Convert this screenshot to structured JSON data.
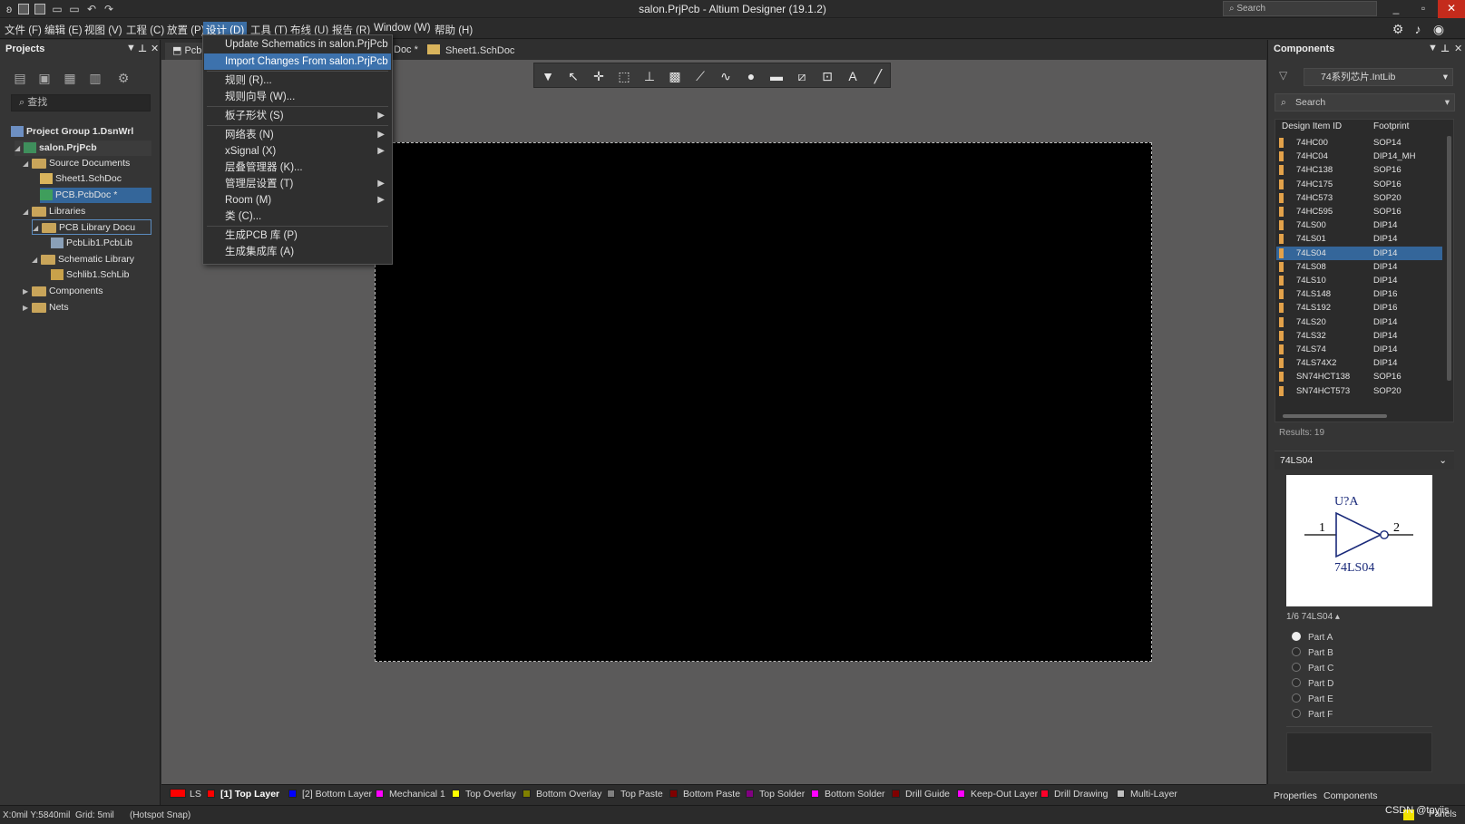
{
  "window": {
    "title": "salon.PrjPcb - Altium Designer (19.1.2)",
    "search_placeholder": "Search"
  },
  "menubar": [
    "文件 (F)",
    "编辑 (E)",
    "视图 (V)",
    "工程 (C)",
    "放置 (P)",
    "设计 (D)",
    "工具 (T)",
    "布线 (U)",
    "报告 (R)",
    "Window (W)",
    "帮助 (H)"
  ],
  "design_menu": {
    "items": [
      {
        "label": "Update Schematics in salon.PrjPcb",
        "submenu": false
      },
      {
        "label": "Import Changes From salon.PrjPcb",
        "submenu": false,
        "highlighted": true
      },
      {
        "label": "规则 (R)...",
        "submenu": false
      },
      {
        "label": "规则向导 (W)...",
        "submenu": false
      },
      {
        "label": "板子形状 (S)",
        "submenu": true
      },
      {
        "label": "网络表 (N)",
        "submenu": true
      },
      {
        "label": "xSignal (X)",
        "submenu": true
      },
      {
        "label": "层叠管理器 (K)...",
        "submenu": false
      },
      {
        "label": "管理层设置 (T)",
        "submenu": true
      },
      {
        "label": "Room (M)",
        "submenu": true
      },
      {
        "label": "类 (C)...",
        "submenu": false
      },
      {
        "label": "生成PCB 库 (P)",
        "submenu": false
      },
      {
        "label": "生成集成库 (A)",
        "submenu": false
      }
    ]
  },
  "projects_panel": {
    "title": "Projects",
    "search_placeholder": "查找",
    "tree": [
      {
        "label": "Project Group 1.DsnWrl",
        "bold": true
      },
      {
        "label": "salon.PrjPcb",
        "bold": true
      },
      {
        "label": "Source Documents"
      },
      {
        "label": "Sheet1.SchDoc"
      },
      {
        "label": "PCB.PcbDoc *",
        "selected": true
      },
      {
        "label": "Libraries"
      },
      {
        "label": "PCB Library Docu"
      },
      {
        "label": "PcbLib1.PcbLib"
      },
      {
        "label": "Schematic Library"
      },
      {
        "label": "Schlib1.SchLib"
      },
      {
        "label": "Components"
      },
      {
        "label": "Nets"
      }
    ]
  },
  "doc_tabs": [
    "Pcb",
    "Doc *",
    "Sheet1.SchDoc"
  ],
  "layers": [
    {
      "label": "LS",
      "color": "#ff0000"
    },
    {
      "label": "[1] Top Layer",
      "color": "#ff0000",
      "active": true
    },
    {
      "label": "[2] Bottom Layer",
      "color": "#0000ff"
    },
    {
      "label": "Mechanical 1",
      "color": "#ff00ff"
    },
    {
      "label": "Top Overlay",
      "color": "#ffff00"
    },
    {
      "label": "Bottom Overlay",
      "color": "#808000"
    },
    {
      "label": "Top Paste",
      "color": "#808080"
    },
    {
      "label": "Bottom Paste",
      "color": "#800000"
    },
    {
      "label": "Top Solder",
      "color": "#800080"
    },
    {
      "label": "Bottom Solder",
      "color": "#ff00ff"
    },
    {
      "label": "Drill Guide",
      "color": "#800000"
    },
    {
      "label": "Keep-Out Layer",
      "color": "#ff00ff"
    },
    {
      "label": "Drill Drawing",
      "color": "#ff002a"
    },
    {
      "label": "Multi-Layer",
      "color": "#c0c0c0"
    }
  ],
  "status": {
    "coords": "X:0mil Y:5840mil",
    "grid": "Grid: 5mil",
    "snap": "(Hotspot Snap)"
  },
  "components_panel": {
    "title": "Components",
    "library": "74系列芯片.IntLib",
    "search_placeholder": "Search",
    "columns": [
      "Design Item ID",
      "Footprint"
    ],
    "rows": [
      [
        "74HC00",
        "SOP14"
      ],
      [
        "74HC04",
        "DIP14_MH"
      ],
      [
        "74HC138",
        "SOP16"
      ],
      [
        "74HC175",
        "SOP16"
      ],
      [
        "74HC573",
        "SOP20"
      ],
      [
        "74HC595",
        "SOP16"
      ],
      [
        "74LS00",
        "DIP14"
      ],
      [
        "74LS01",
        "DIP14"
      ],
      [
        "74LS04",
        "DIP14"
      ],
      [
        "74LS08",
        "DIP14"
      ],
      [
        "74LS10",
        "DIP14"
      ],
      [
        "74LS148",
        "DIP16"
      ],
      [
        "74LS192",
        "DIP16"
      ],
      [
        "74LS20",
        "DIP14"
      ],
      [
        "74LS32",
        "DIP14"
      ],
      [
        "74LS74",
        "DIP14"
      ],
      [
        "74LS74X2",
        "DIP14"
      ],
      [
        "SN74HCT138",
        "SOP16"
      ],
      [
        "SN74HCT573",
        "SOP20"
      ]
    ],
    "selected_row": 8,
    "results": "Results: 19",
    "detail_title": "74LS04",
    "symbol": {
      "designator": "U?A",
      "comment": "74LS04",
      "pin_in": "1",
      "pin_out": "2"
    },
    "part_selector": "1/6  74LS04 ▴",
    "parts": [
      "Part A",
      "Part B",
      "Part C",
      "Part D",
      "Part E",
      "Part F"
    ],
    "selected_part": 0
  },
  "bottom_tabs": [
    "Properties",
    "Components"
  ],
  "panels_button": "Panels",
  "watermark": "CSDN @toyjis"
}
